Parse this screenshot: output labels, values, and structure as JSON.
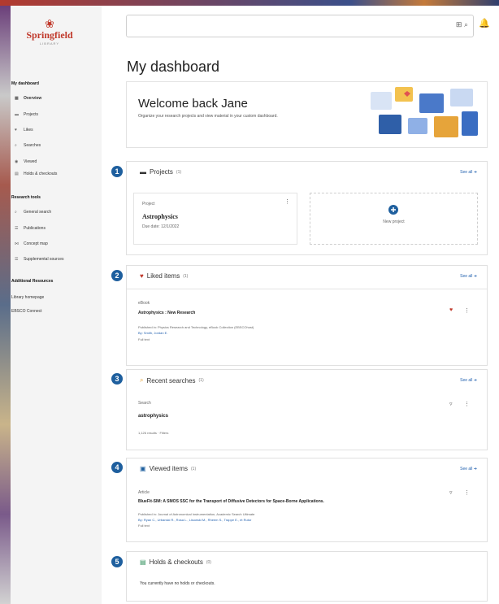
{
  "brand": {
    "logo_mark": "❀",
    "name": "Springfield",
    "sub": "LIBRARY"
  },
  "sidebar": {
    "heading": "My dashboard",
    "items": [
      {
        "label": "Overview",
        "icon": "grid-icon",
        "glyph": "▦"
      },
      {
        "label": "Projects",
        "icon": "folder-icon",
        "glyph": "▬"
      },
      {
        "label": "Likes",
        "icon": "heart-icon",
        "glyph": "♥"
      },
      {
        "label": "Searches",
        "icon": "search-icon",
        "glyph": "⌕"
      },
      {
        "label": "Viewed",
        "icon": "eye-icon",
        "glyph": "◉"
      },
      {
        "label": "Holds & checkouts",
        "icon": "book-icon",
        "glyph": "▤"
      }
    ],
    "research_heading": "Research tools",
    "research_items": [
      {
        "label": "General search",
        "icon": "search-icon",
        "glyph": "⌕"
      },
      {
        "label": "Publications",
        "icon": "list-icon",
        "glyph": "☰"
      },
      {
        "label": "Concept map",
        "icon": "map-icon",
        "glyph": "⋈"
      },
      {
        "label": "Supplemental sources",
        "icon": "list-icon",
        "glyph": "☰"
      }
    ],
    "resources_heading": "Additional Resources",
    "resources": [
      "Library homepage",
      "EBSCO Connect"
    ]
  },
  "search": {
    "placeholder": "",
    "icons": "⊞ ⌕"
  },
  "bell_icon": "🔔",
  "page_title": "My dashboard",
  "welcome": {
    "title": "Welcome back Jane",
    "text": "Organize your research projects and view material in your custom dashboard."
  },
  "projects": {
    "number": "1",
    "title": "Projects",
    "count": "(1)",
    "see_all": "See all ➔",
    "card": {
      "kicker": "Project",
      "name": "Astrophysics",
      "meta": "Due date: 12/1/2022"
    },
    "new_label": "New project"
  },
  "liked": {
    "number": "2",
    "title": "Liked items",
    "count": "(1)",
    "see_all": "See all ➔",
    "item": {
      "kind": "eBook",
      "title": "Astrophysics : New Research",
      "published": "Published in: Physics Research and Technology, eBook Collection (EBSCOhost)",
      "by": "By: Smith, Jordan E.",
      "extra": "Full text"
    }
  },
  "searches": {
    "number": "3",
    "title": "Recent searches",
    "count": "(1)",
    "see_all": "See all ➔",
    "item": {
      "kind": "Search",
      "query": "astrophysics",
      "meta": "1,126 results  ·  Filters"
    }
  },
  "viewed": {
    "number": "4",
    "title": "Viewed items",
    "count": "(1)",
    "see_all": "See all ➔",
    "item": {
      "kind": "Article",
      "title": "BlueFit-SIM: A SMOS SSC for the Transport of Diffusive Detectors for Space-Borne Applications.",
      "published": "Published in: Journal of Astronomical Instrumentation, Academic Search Ultimate",
      "by": "By: Ryan C., Urbanski R., Rosa L., Lisowski M., Rheem S., Trappe E., et Rutor",
      "extra": "Full text"
    }
  },
  "holds": {
    "number": "5",
    "title": "Holds & checkouts",
    "count": "(0)",
    "empty": "You currently have no holds or checkouts."
  }
}
